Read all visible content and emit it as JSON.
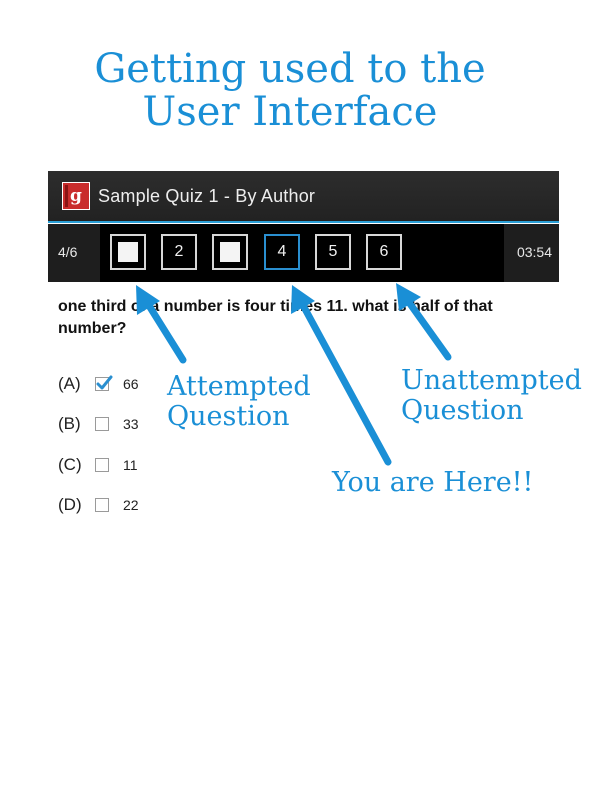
{
  "headline": {
    "line1": "Getting used to the",
    "line2": "User Interface"
  },
  "app": {
    "logo_glyph": "g",
    "title": "Sample Quiz 1 - By Author",
    "accent_color": "#2a9fd6"
  },
  "navigator": {
    "counter": "4/6",
    "timer": "03:54",
    "questions": [
      {
        "label": "",
        "state": "attempted"
      },
      {
        "label": "2",
        "state": "unattempted"
      },
      {
        "label": "",
        "state": "attempted"
      },
      {
        "label": "4",
        "state": "current"
      },
      {
        "label": "5",
        "state": "unattempted"
      },
      {
        "label": "6",
        "state": "unattempted"
      }
    ]
  },
  "question": {
    "text": "one third of a number is four times 11. what is half of that number?"
  },
  "options": [
    {
      "letter": "(A)",
      "value": "66",
      "checked": true
    },
    {
      "letter": "(B)",
      "value": "33",
      "checked": false
    },
    {
      "letter": "(C)",
      "value": "11",
      "checked": false
    },
    {
      "letter": "(D)",
      "value": "22",
      "checked": false
    }
  ],
  "callouts": {
    "attempted": {
      "line1": "Attempted",
      "line2": "Question"
    },
    "unattempted": {
      "line1": "Unattempted",
      "line2": "Question"
    },
    "here": "You are Here!!"
  },
  "colors": {
    "annotation": "#1a8fd6",
    "check": "#2a8fd0",
    "current_border": "#2a8fd0"
  },
  "icons": {
    "logo": "app-logo-icon",
    "check": "checkmark-icon",
    "arrow": "pointer-arrow-icon"
  }
}
